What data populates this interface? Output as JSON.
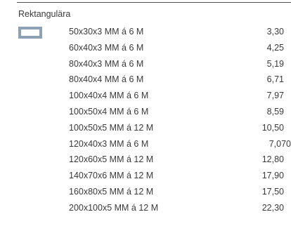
{
  "section": {
    "title": "Rektangulära",
    "icon": "rectangular-tube-profile-icon",
    "icon_color": "#8da1b6"
  },
  "rows": [
    {
      "desc": "50x30x3 MM á 6 M",
      "price": "3,30"
    },
    {
      "desc": "60x40x3 MM á 6 M",
      "price": "4,25"
    },
    {
      "desc": "80x40x3 MM á 6 M",
      "price": "5,19"
    },
    {
      "desc": "80x40x4 MM á 6 M",
      "price": "6,71"
    },
    {
      "desc": "100x40x4 MM á 6 M",
      "price": "7,97"
    },
    {
      "desc": "100x50x4 MM á 6 M",
      "price": "8,59"
    },
    {
      "desc": "100x50x5 MM á 12 M",
      "price": "10,50"
    },
    {
      "desc": "120x40x3 MM á 6 M",
      "price": "7,070"
    },
    {
      "desc": "120x60x5 MM á 12 M",
      "price": "12,80"
    },
    {
      "desc": "140x70x6 MM á 12 M",
      "price": "17,90"
    },
    {
      "desc": "160x80x5 MM á 12 M",
      "price": "17,50"
    },
    {
      "desc": "200x100x5 MM á 12 M",
      "price": "22,30"
    }
  ]
}
